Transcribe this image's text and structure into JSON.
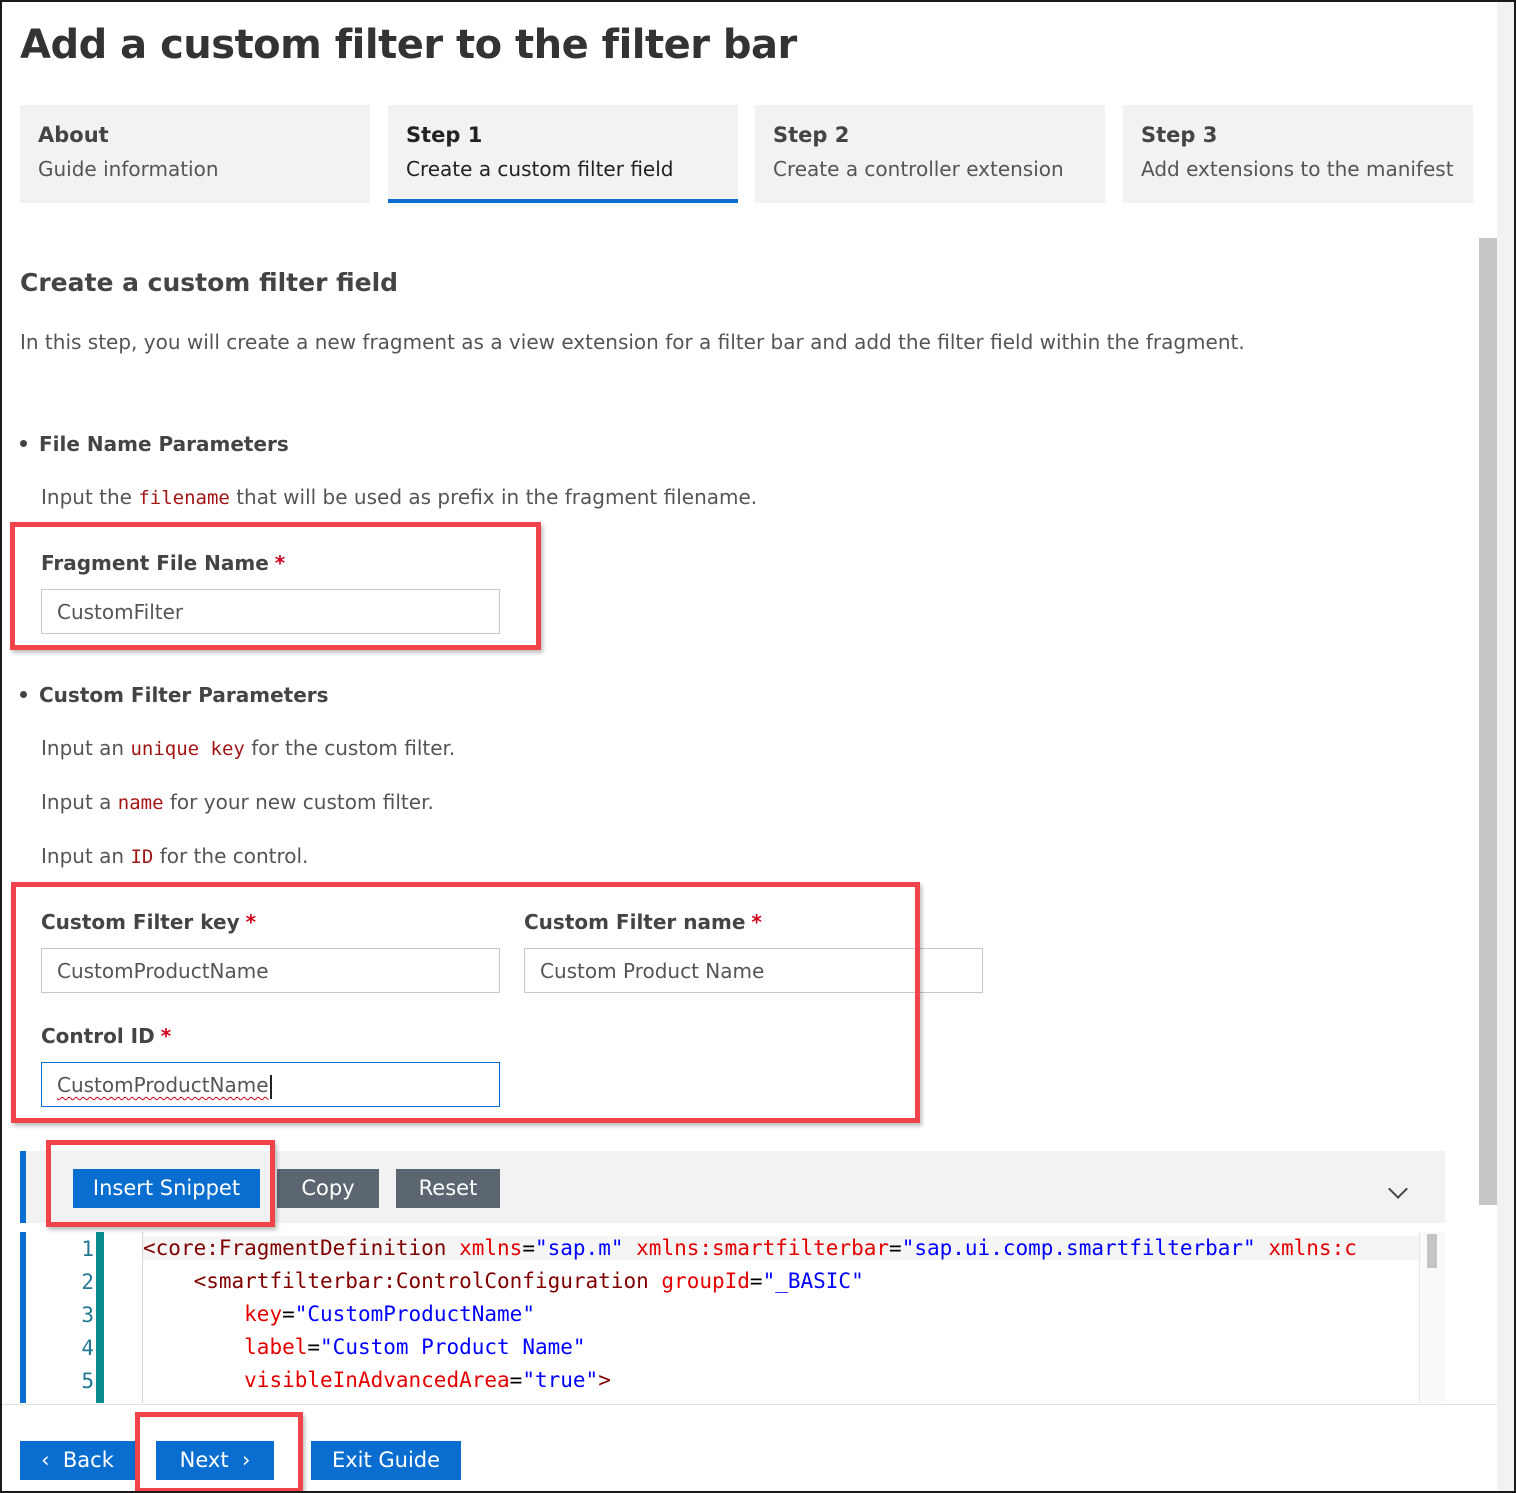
{
  "page": {
    "title": "Add a custom filter to the filter bar"
  },
  "tabs": [
    {
      "heading": "About",
      "subtitle": "Guide information",
      "active": false
    },
    {
      "heading": "Step 1",
      "subtitle": "Create a custom filter field",
      "active": true
    },
    {
      "heading": "Step 2",
      "subtitle": "Create a controller extension",
      "active": false
    },
    {
      "heading": "Step 3",
      "subtitle": "Add extensions to the manifest",
      "active": false
    }
  ],
  "section": {
    "heading": "Create a custom filter field",
    "description": "In this step, you will create a new fragment as a view extension for a filter bar and add the filter field within the fragment."
  },
  "file_params": {
    "heading": "File Name Parameters",
    "instruction_pre": "Input the",
    "instruction_code": "filename",
    "instruction_post": "that will be used as prefix in the fragment filename.",
    "fragment_label": "Fragment File Name",
    "required_mark": "*",
    "fragment_value": "CustomFilter"
  },
  "filter_params": {
    "heading": "Custom Filter Parameters",
    "line1_pre": "Input an",
    "line1_code": "unique key",
    "line1_post": "for the custom filter.",
    "line2_pre": "Input a",
    "line2_code": "name",
    "line2_post": "for your new custom filter.",
    "line3_pre": "Input an",
    "line3_code": "ID",
    "line3_post": "for the control.",
    "key_label": "Custom Filter key",
    "key_value": "CustomProductName",
    "name_label": "Custom Filter name",
    "name_value": "Custom Product Name",
    "control_label": "Control ID",
    "control_value": "CustomProductName",
    "required_mark": "*"
  },
  "toolbar": {
    "insert_label": "Insert Snippet",
    "copy_label": "Copy",
    "reset_label": "Reset",
    "collapse_icon": "chevron-down-icon"
  },
  "editor": {
    "line_numbers": [
      "1",
      "2",
      "3",
      "4",
      "5"
    ],
    "lines": [
      {
        "indent": "",
        "p1": "<",
        "tag": "core:FragmentDefinition",
        "a1": "xmlns",
        "v1": "\"sap.m\"",
        "a2": "xmlns:smartfilterbar",
        "v2": "\"sap.ui.comp.smartfilterbar\"",
        "a3": "xmlns:",
        "v3": "c"
      },
      {
        "indent": "    ",
        "p1": "<",
        "tag": "smartfilterbar:ControlConfiguration",
        "a1": "groupId",
        "v1": "\"_BASIC\""
      },
      {
        "indent": "        ",
        "a1": "key",
        "v1": "\"CustomProductName\""
      },
      {
        "indent": "        ",
        "a1": "label",
        "v1": "\"Custom Product Name\""
      },
      {
        "indent": "        ",
        "a1": "visibleInAdvancedArea",
        "v1": "\"true\"",
        "p2": ">"
      }
    ]
  },
  "footer": {
    "back_label": "Back",
    "next_label": "Next",
    "exit_label": "Exit Guide"
  },
  "colors": {
    "accent": "#0a6ed1",
    "highlight": "#f0444a",
    "required": "#d0021b",
    "gutter_bar": "#0b8c8c"
  }
}
